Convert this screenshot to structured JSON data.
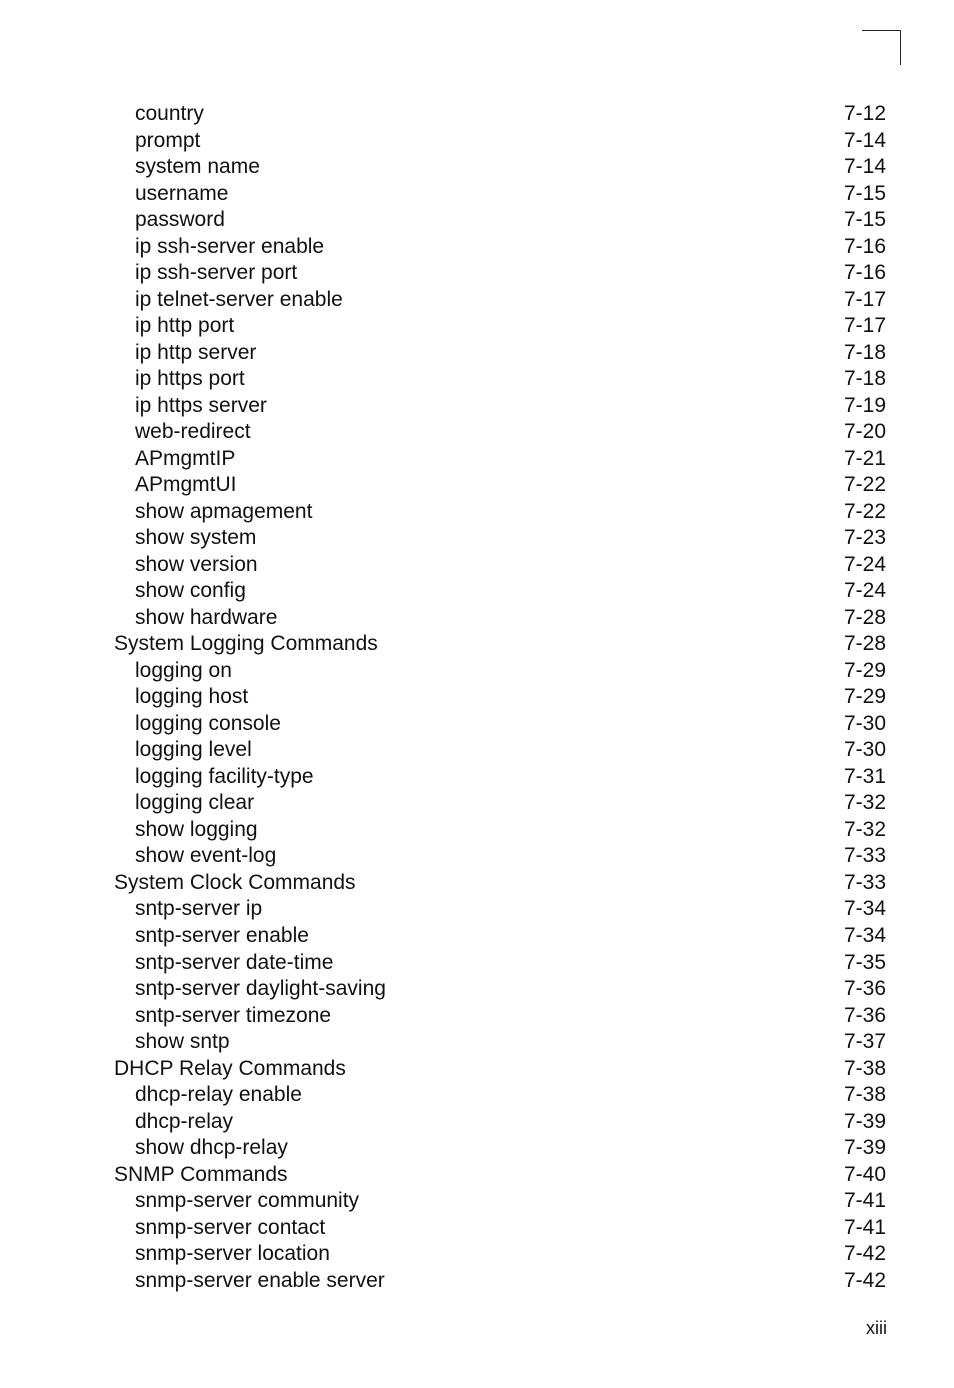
{
  "entries": [
    {
      "title": "country",
      "page": "7-12",
      "level": "sub"
    },
    {
      "title": "prompt",
      "page": "7-14",
      "level": "sub"
    },
    {
      "title": "system name",
      "page": "7-14",
      "level": "sub"
    },
    {
      "title": "username",
      "page": "7-15",
      "level": "sub"
    },
    {
      "title": "password",
      "page": "7-15",
      "level": "sub"
    },
    {
      "title": "ip ssh-server enable",
      "page": "7-16",
      "level": "sub"
    },
    {
      "title": "ip ssh-server port",
      "page": "7-16",
      "level": "sub"
    },
    {
      "title": "ip telnet-server enable",
      "page": "7-17",
      "level": "sub"
    },
    {
      "title": "ip http port",
      "page": "7-17",
      "level": "sub"
    },
    {
      "title": "ip http server",
      "page": "7-18",
      "level": "sub"
    },
    {
      "title": "ip https port",
      "page": "7-18",
      "level": "sub"
    },
    {
      "title": "ip https server",
      "page": "7-19",
      "level": "sub"
    },
    {
      "title": "web-redirect",
      "page": "7-20",
      "level": "sub"
    },
    {
      "title": "APmgmtIP",
      "page": "7-21",
      "level": "sub"
    },
    {
      "title": "APmgmtUI",
      "page": "7-22",
      "level": "sub"
    },
    {
      "title": "show apmagement",
      "page": "7-22",
      "level": "sub"
    },
    {
      "title": "show system",
      "page": "7-23",
      "level": "sub"
    },
    {
      "title": "show version",
      "page": "7-24",
      "level": "sub"
    },
    {
      "title": "show config",
      "page": "7-24",
      "level": "sub"
    },
    {
      "title": "show hardware",
      "page": "7-28",
      "level": "sub"
    },
    {
      "title": "System Logging Commands",
      "page": "7-28",
      "level": "section"
    },
    {
      "title": "logging on",
      "page": "7-29",
      "level": "sub"
    },
    {
      "title": "logging host",
      "page": "7-29",
      "level": "sub"
    },
    {
      "title": "logging console",
      "page": "7-30",
      "level": "sub"
    },
    {
      "title": "logging level",
      "page": "7-30",
      "level": "sub"
    },
    {
      "title": "logging facility-type",
      "page": "7-31",
      "level": "sub"
    },
    {
      "title": "logging clear",
      "page": "7-32",
      "level": "sub"
    },
    {
      "title": "show logging",
      "page": "7-32",
      "level": "sub"
    },
    {
      "title": "show event-log",
      "page": "7-33",
      "level": "sub"
    },
    {
      "title": "System Clock Commands",
      "page": "7-33",
      "level": "section"
    },
    {
      "title": "sntp-server ip",
      "page": "7-34",
      "level": "sub"
    },
    {
      "title": "sntp-server enable",
      "page": "7-34",
      "level": "sub"
    },
    {
      "title": "sntp-server date-time",
      "page": "7-35",
      "level": "sub"
    },
    {
      "title": "sntp-server daylight-saving",
      "page": "7-36",
      "level": "sub"
    },
    {
      "title": "sntp-server timezone",
      "page": "7-36",
      "level": "sub"
    },
    {
      "title": "show sntp",
      "page": "7-37",
      "level": "sub"
    },
    {
      "title": "DHCP Relay Commands",
      "page": "7-38",
      "level": "section"
    },
    {
      "title": "dhcp-relay enable",
      "page": "7-38",
      "level": "sub"
    },
    {
      "title": "dhcp-relay",
      "page": "7-39",
      "level": "sub"
    },
    {
      "title": "show dhcp-relay",
      "page": "7-39",
      "level": "sub"
    },
    {
      "title": "SNMP Commands",
      "page": "7-40",
      "level": "section"
    },
    {
      "title": "snmp-server community",
      "page": "7-41",
      "level": "sub"
    },
    {
      "title": "snmp-server contact",
      "page": "7-41",
      "level": "sub"
    },
    {
      "title": "snmp-server location",
      "page": "7-42",
      "level": "sub"
    },
    {
      "title": "snmp-server enable server",
      "page": "7-42",
      "level": "sub"
    }
  ],
  "footer": {
    "page_number": "xiii"
  }
}
